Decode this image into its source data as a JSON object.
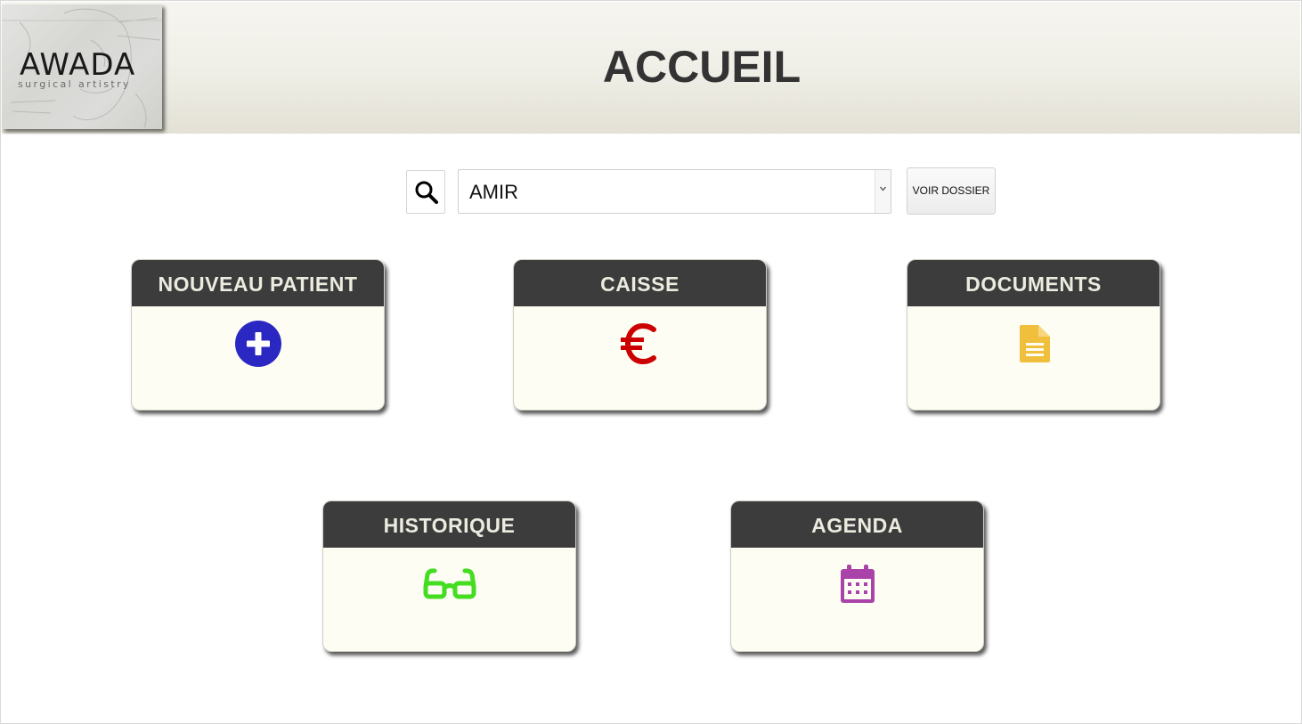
{
  "header": {
    "title": "ACCUEIL",
    "logo": {
      "wordmark": "AWADA",
      "tagline": "surgical artistry"
    }
  },
  "search": {
    "icon": "search-icon",
    "selected_patient": "AMIR",
    "dropdown_icon": "chevron-down-icon",
    "button_label": "VOIR DOSSIER"
  },
  "cards": [
    {
      "label": "NOUVEAU PATIENT",
      "icon": "plus-circle-icon",
      "color": "#2b27c2"
    },
    {
      "label": "CAISSE",
      "icon": "euro-icon",
      "color": "#cc0000"
    },
    {
      "label": "DOCUMENTS",
      "icon": "file-icon",
      "color": "#f0bf3c"
    },
    {
      "label": "HISTORIQUE",
      "icon": "glasses-icon",
      "color": "#44dd22"
    },
    {
      "label": "AGENDA",
      "icon": "calendar-icon",
      "color": "#a943a9"
    }
  ],
  "colors": {
    "card_header_bg": "#3c3c3c",
    "card_body_bg": "#fdfdf3",
    "title_text": "#333333"
  }
}
